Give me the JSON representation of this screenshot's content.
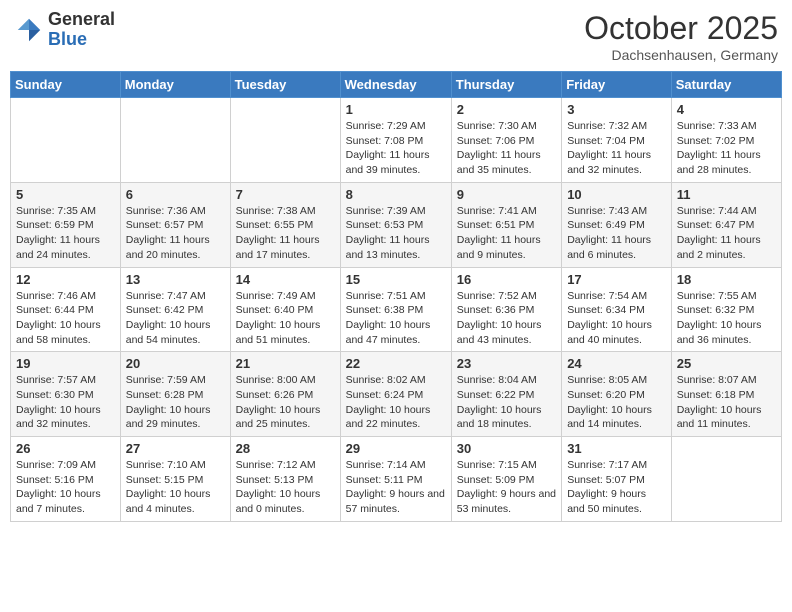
{
  "header": {
    "logo_general": "General",
    "logo_blue": "Blue",
    "month_title": "October 2025",
    "location": "Dachsenhausen, Germany"
  },
  "days_of_week": [
    "Sunday",
    "Monday",
    "Tuesday",
    "Wednesday",
    "Thursday",
    "Friday",
    "Saturday"
  ],
  "weeks": [
    [
      {
        "day": "",
        "info": ""
      },
      {
        "day": "",
        "info": ""
      },
      {
        "day": "",
        "info": ""
      },
      {
        "day": "1",
        "info": "Sunrise: 7:29 AM\nSunset: 7:08 PM\nDaylight: 11 hours and 39 minutes."
      },
      {
        "day": "2",
        "info": "Sunrise: 7:30 AM\nSunset: 7:06 PM\nDaylight: 11 hours and 35 minutes."
      },
      {
        "day": "3",
        "info": "Sunrise: 7:32 AM\nSunset: 7:04 PM\nDaylight: 11 hours and 32 minutes."
      },
      {
        "day": "4",
        "info": "Sunrise: 7:33 AM\nSunset: 7:02 PM\nDaylight: 11 hours and 28 minutes."
      }
    ],
    [
      {
        "day": "5",
        "info": "Sunrise: 7:35 AM\nSunset: 6:59 PM\nDaylight: 11 hours and 24 minutes."
      },
      {
        "day": "6",
        "info": "Sunrise: 7:36 AM\nSunset: 6:57 PM\nDaylight: 11 hours and 20 minutes."
      },
      {
        "day": "7",
        "info": "Sunrise: 7:38 AM\nSunset: 6:55 PM\nDaylight: 11 hours and 17 minutes."
      },
      {
        "day": "8",
        "info": "Sunrise: 7:39 AM\nSunset: 6:53 PM\nDaylight: 11 hours and 13 minutes."
      },
      {
        "day": "9",
        "info": "Sunrise: 7:41 AM\nSunset: 6:51 PM\nDaylight: 11 hours and 9 minutes."
      },
      {
        "day": "10",
        "info": "Sunrise: 7:43 AM\nSunset: 6:49 PM\nDaylight: 11 hours and 6 minutes."
      },
      {
        "day": "11",
        "info": "Sunrise: 7:44 AM\nSunset: 6:47 PM\nDaylight: 11 hours and 2 minutes."
      }
    ],
    [
      {
        "day": "12",
        "info": "Sunrise: 7:46 AM\nSunset: 6:44 PM\nDaylight: 10 hours and 58 minutes."
      },
      {
        "day": "13",
        "info": "Sunrise: 7:47 AM\nSunset: 6:42 PM\nDaylight: 10 hours and 54 minutes."
      },
      {
        "day": "14",
        "info": "Sunrise: 7:49 AM\nSunset: 6:40 PM\nDaylight: 10 hours and 51 minutes."
      },
      {
        "day": "15",
        "info": "Sunrise: 7:51 AM\nSunset: 6:38 PM\nDaylight: 10 hours and 47 minutes."
      },
      {
        "day": "16",
        "info": "Sunrise: 7:52 AM\nSunset: 6:36 PM\nDaylight: 10 hours and 43 minutes."
      },
      {
        "day": "17",
        "info": "Sunrise: 7:54 AM\nSunset: 6:34 PM\nDaylight: 10 hours and 40 minutes."
      },
      {
        "day": "18",
        "info": "Sunrise: 7:55 AM\nSunset: 6:32 PM\nDaylight: 10 hours and 36 minutes."
      }
    ],
    [
      {
        "day": "19",
        "info": "Sunrise: 7:57 AM\nSunset: 6:30 PM\nDaylight: 10 hours and 32 minutes."
      },
      {
        "day": "20",
        "info": "Sunrise: 7:59 AM\nSunset: 6:28 PM\nDaylight: 10 hours and 29 minutes."
      },
      {
        "day": "21",
        "info": "Sunrise: 8:00 AM\nSunset: 6:26 PM\nDaylight: 10 hours and 25 minutes."
      },
      {
        "day": "22",
        "info": "Sunrise: 8:02 AM\nSunset: 6:24 PM\nDaylight: 10 hours and 22 minutes."
      },
      {
        "day": "23",
        "info": "Sunrise: 8:04 AM\nSunset: 6:22 PM\nDaylight: 10 hours and 18 minutes."
      },
      {
        "day": "24",
        "info": "Sunrise: 8:05 AM\nSunset: 6:20 PM\nDaylight: 10 hours and 14 minutes."
      },
      {
        "day": "25",
        "info": "Sunrise: 8:07 AM\nSunset: 6:18 PM\nDaylight: 10 hours and 11 minutes."
      }
    ],
    [
      {
        "day": "26",
        "info": "Sunrise: 7:09 AM\nSunset: 5:16 PM\nDaylight: 10 hours and 7 minutes."
      },
      {
        "day": "27",
        "info": "Sunrise: 7:10 AM\nSunset: 5:15 PM\nDaylight: 10 hours and 4 minutes."
      },
      {
        "day": "28",
        "info": "Sunrise: 7:12 AM\nSunset: 5:13 PM\nDaylight: 10 hours and 0 minutes."
      },
      {
        "day": "29",
        "info": "Sunrise: 7:14 AM\nSunset: 5:11 PM\nDaylight: 9 hours and 57 minutes."
      },
      {
        "day": "30",
        "info": "Sunrise: 7:15 AM\nSunset: 5:09 PM\nDaylight: 9 hours and 53 minutes."
      },
      {
        "day": "31",
        "info": "Sunrise: 7:17 AM\nSunset: 5:07 PM\nDaylight: 9 hours and 50 minutes."
      },
      {
        "day": "",
        "info": ""
      }
    ]
  ]
}
